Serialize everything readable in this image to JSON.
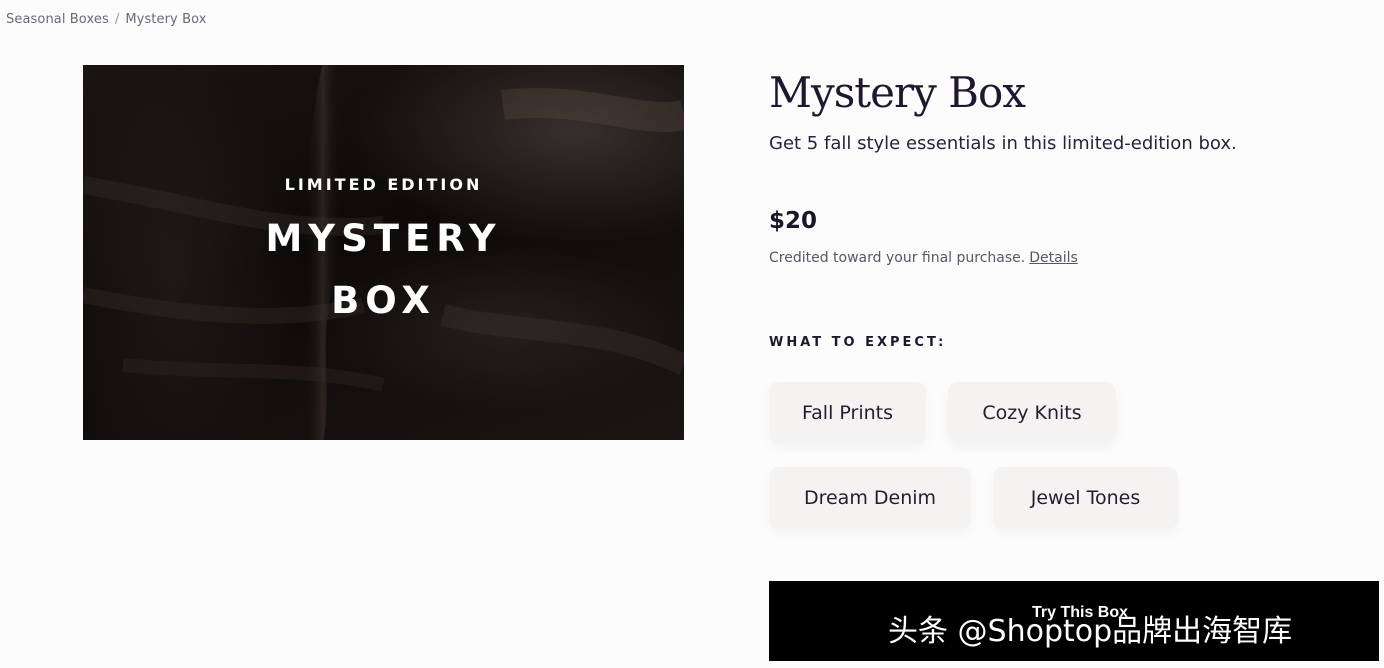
{
  "breadcrumb": {
    "items": [
      "Seasonal Boxes",
      "Mystery Box"
    ],
    "separator": "/"
  },
  "hero": {
    "kicker": "LIMITED EDITION",
    "title_line1": "MYSTERY",
    "title_line2": "BOX"
  },
  "product": {
    "title": "Mystery Box",
    "subtitle": "Get 5 fall style essentials in this limited-edition box.",
    "price": "$20",
    "credit_text": "Credited toward your final purchase.",
    "details_link": "Details"
  },
  "expect": {
    "label": "WHAT TO EXPECT:",
    "tags": [
      "Fall Prints",
      "Cozy Knits",
      "Dream Denim",
      "Jewel Tones"
    ]
  },
  "cta": {
    "label": "Try This Box"
  },
  "watermark": {
    "text": "头条 @Shoptop品牌出海智库"
  },
  "colors": {
    "background": "#fcfcfd",
    "text_primary": "#1f1730",
    "tag_bg": "#f5f3f2",
    "cta_bg": "#000000"
  }
}
